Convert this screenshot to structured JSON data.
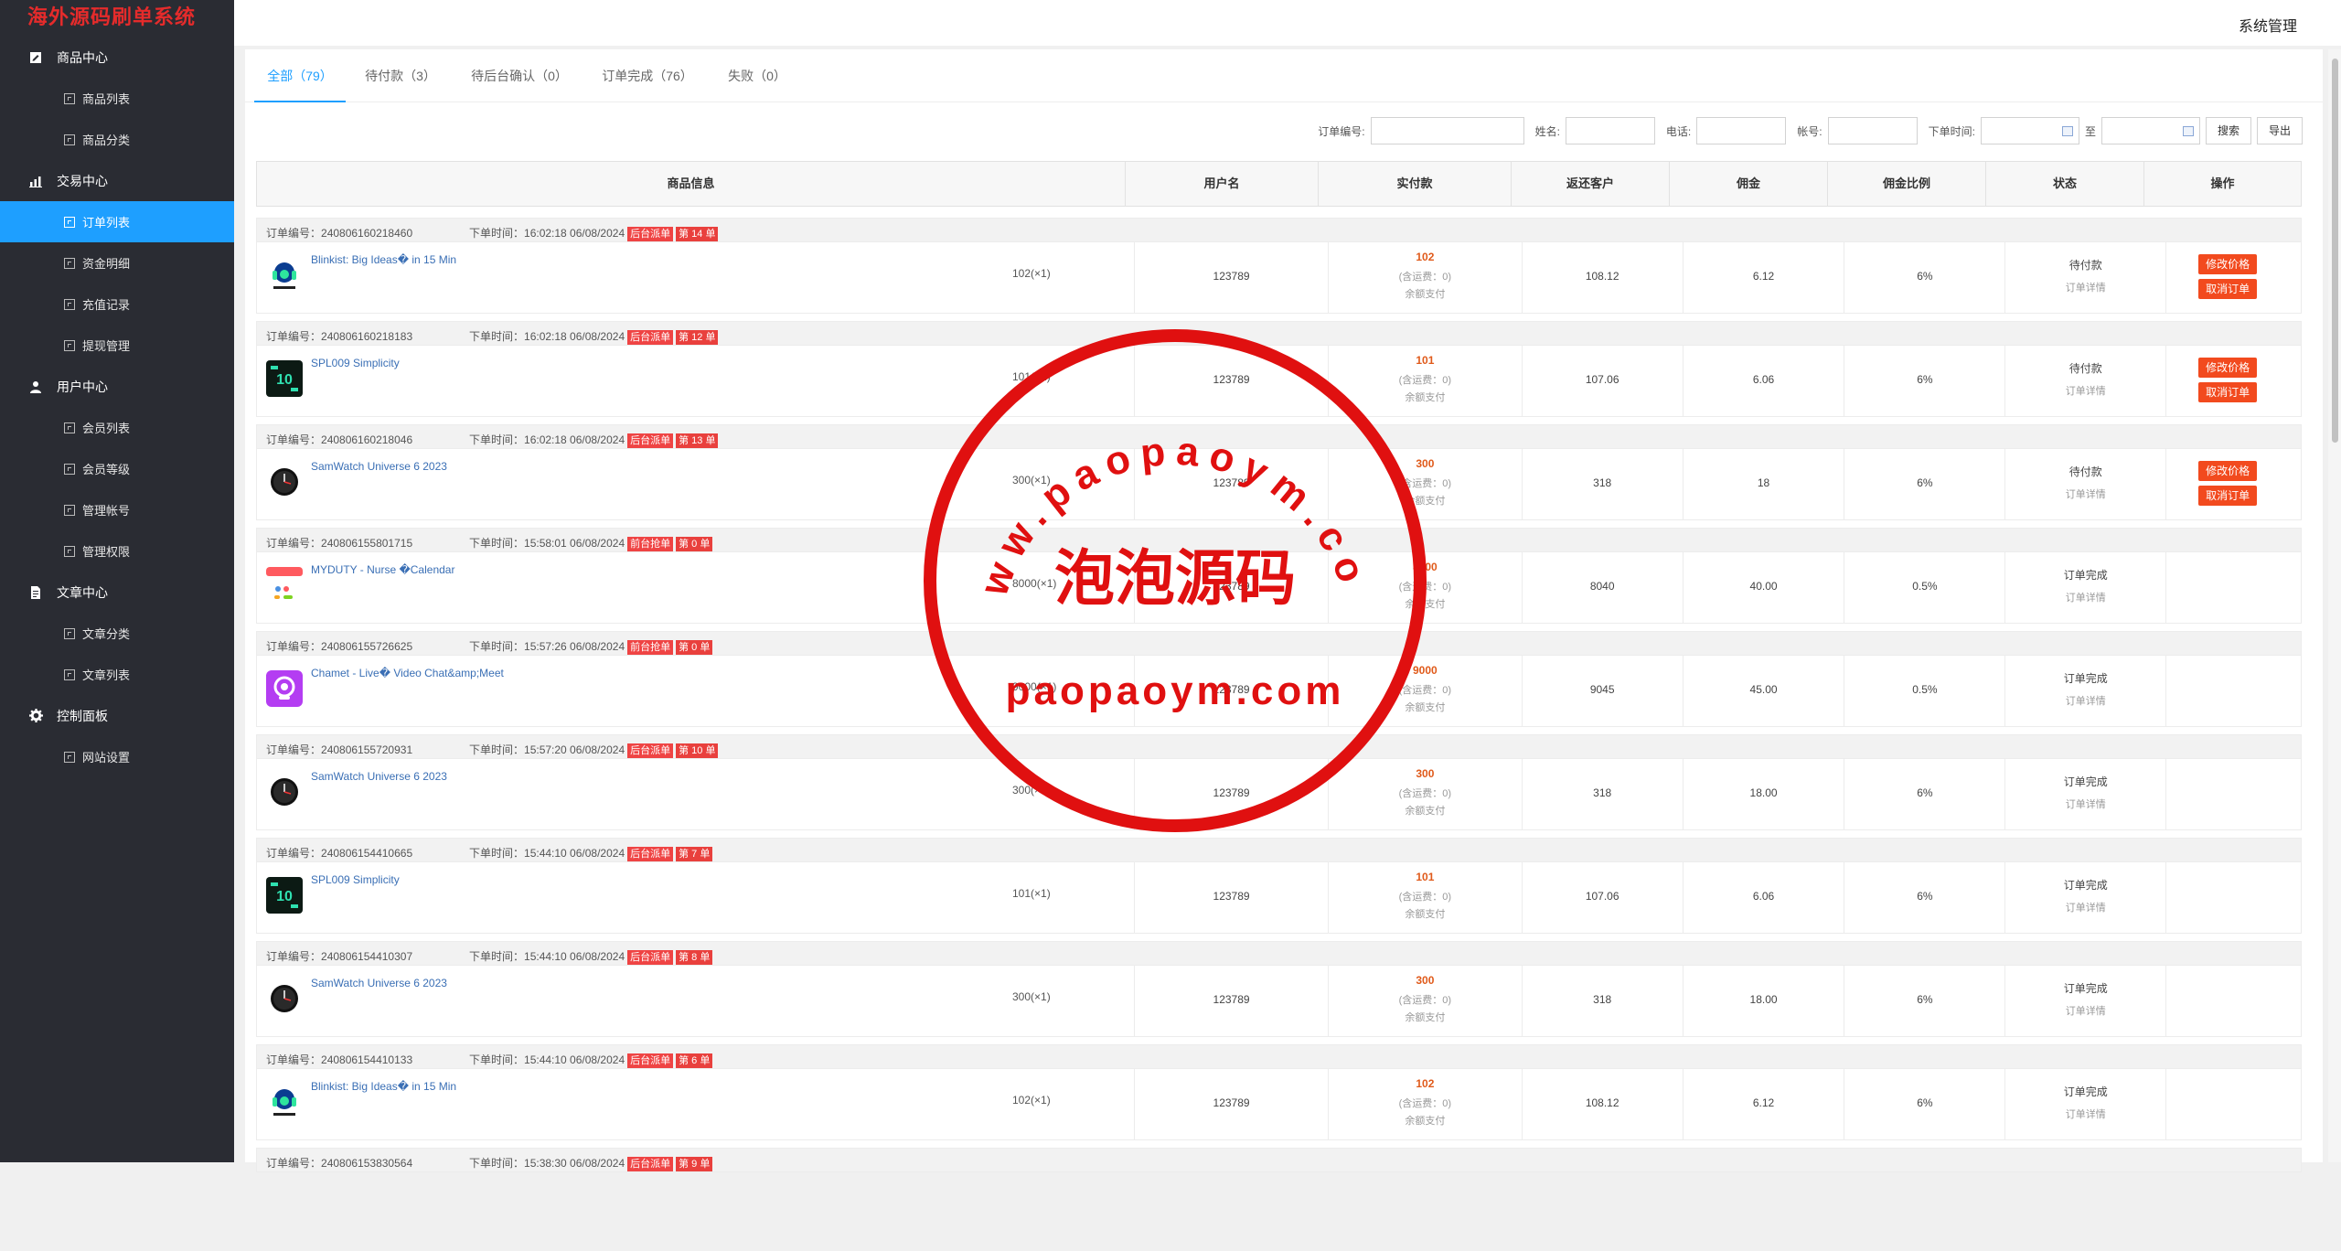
{
  "brand": "海外源码刷单系统",
  "header": {
    "title": "系统管理"
  },
  "sidebar": {
    "groups": [
      {
        "label": "商品中心",
        "icon": "edit-icon",
        "items": [
          "商品列表",
          "商品分类"
        ]
      },
      {
        "label": "交易中心",
        "icon": "bar-chart-icon",
        "items": [
          "订单列表",
          "资金明细",
          "充值记录",
          "提现管理"
        ]
      },
      {
        "label": "用户中心",
        "icon": "user-icon",
        "items": [
          "会员列表",
          "会员等级",
          "管理帐号",
          "管理权限"
        ]
      },
      {
        "label": "文章中心",
        "icon": "document-icon",
        "items": [
          "文章分类",
          "文章列表"
        ]
      },
      {
        "label": "控制面板",
        "icon": "gear-icon",
        "items": [
          "网站设置"
        ]
      }
    ],
    "active_item": "订单列表"
  },
  "tabs": [
    {
      "label": "全部（79）",
      "active": true
    },
    {
      "label": "待付款（3）",
      "active": false
    },
    {
      "label": "待后台确认（0）",
      "active": false
    },
    {
      "label": "订单完成（76）",
      "active": false
    },
    {
      "label": "失败（0）",
      "active": false
    }
  ],
  "filters": {
    "order_no_label": "订单编号:",
    "name_label": "姓名:",
    "phone_label": "电话:",
    "account_label": "帐号:",
    "time_label": "下单时间:",
    "to_label": "至",
    "search_btn": "搜索",
    "export_btn": "导出"
  },
  "columns": [
    "商品信息",
    "用户名",
    "实付款",
    "返还客户",
    "佣金",
    "佣金比例",
    "状态",
    "操作"
  ],
  "labels": {
    "order_no_prefix": "订单编号：",
    "order_time_prefix": "下单时间：",
    "ship_fee": "(含运费：0)",
    "pay_mode": "余额支付",
    "detail": "订单详情",
    "edit_price": "修改价格",
    "cancel_order": "取消订单"
  },
  "orders": [
    {
      "no": "240806160218460",
      "time": "16:02:18 06/08/2024",
      "badge": "后台派单",
      "count": "第 14 单",
      "product": "Blinkist: Big Ideas� in 15 Min",
      "thumb": "blinkist",
      "qty": "102(×1)",
      "user": "123789",
      "paid": "102",
      "refund": "108.12",
      "commission": "6.12",
      "rate": "6%",
      "status": "待付款",
      "actions": true
    },
    {
      "no": "240806160218183",
      "time": "16:02:18 06/08/2024",
      "badge": "后台派单",
      "count": "第 12 单",
      "product": "SPL009 Simplicity",
      "thumb": "watch10",
      "qty": "101(×1)",
      "user": "123789",
      "paid": "101",
      "refund": "107.06",
      "commission": "6.06",
      "rate": "6%",
      "status": "待付款",
      "actions": true
    },
    {
      "no": "240806160218046",
      "time": "16:02:18 06/08/2024",
      "badge": "后台派单",
      "count": "第 13 单",
      "product": "SamWatch Universe 6 2023",
      "thumb": "samwatch",
      "qty": "300(×1)",
      "user": "123789",
      "paid": "300",
      "refund": "318",
      "commission": "18",
      "rate": "6%",
      "status": "待付款",
      "actions": true
    },
    {
      "no": "240806155801715",
      "time": "15:58:01 06/08/2024",
      "badge": "前台抢单",
      "count": "第 0 单",
      "product": "MYDUTY - Nurse �Calendar",
      "thumb": "myduty",
      "qty": "8000(×1)",
      "user": "123789",
      "paid": "8000",
      "refund": "8040",
      "commission": "40.00",
      "rate": "0.5%",
      "status": "订单完成",
      "actions": false
    },
    {
      "no": "240806155726625",
      "time": "15:57:26 06/08/2024",
      "badge": "前台抢单",
      "count": "第 0 单",
      "product": "Chamet - Live� Video Chat&amp;Meet",
      "thumb": "chamet",
      "qty": "9000(×1)",
      "user": "123789",
      "paid": "9000",
      "refund": "9045",
      "commission": "45.00",
      "rate": "0.5%",
      "status": "订单完成",
      "actions": false
    },
    {
      "no": "240806155720931",
      "time": "15:57:20 06/08/2024",
      "badge": "后台派单",
      "count": "第 10 单",
      "product": "SamWatch Universe 6 2023",
      "thumb": "samwatch",
      "qty": "300(×1)",
      "user": "123789",
      "paid": "300",
      "refund": "318",
      "commission": "18.00",
      "rate": "6%",
      "status": "订单完成",
      "actions": false
    },
    {
      "no": "240806154410665",
      "time": "15:44:10 06/08/2024",
      "badge": "后台派单",
      "count": "第 7 单",
      "product": "SPL009 Simplicity",
      "thumb": "watch10",
      "qty": "101(×1)",
      "user": "123789",
      "paid": "101",
      "refund": "107.06",
      "commission": "6.06",
      "rate": "6%",
      "status": "订单完成",
      "actions": false
    },
    {
      "no": "240806154410307",
      "time": "15:44:10 06/08/2024",
      "badge": "后台派单",
      "count": "第 8 单",
      "product": "SamWatch Universe 6 2023",
      "thumb": "samwatch",
      "qty": "300(×1)",
      "user": "123789",
      "paid": "300",
      "refund": "318",
      "commission": "18.00",
      "rate": "6%",
      "status": "订单完成",
      "actions": false
    },
    {
      "no": "240806154410133",
      "time": "15:44:10 06/08/2024",
      "badge": "后台派单",
      "count": "第 6 单",
      "product": "Blinkist: Big Ideas� in 15 Min",
      "thumb": "blinkist",
      "qty": "102(×1)",
      "user": "123789",
      "paid": "102",
      "refund": "108.12",
      "commission": "6.12",
      "rate": "6%",
      "status": "订单完成",
      "actions": false
    },
    {
      "no": "240806153830564",
      "time": "15:38:30 06/08/2024",
      "badge": "后台派单",
      "count": "第 9 单",
      "product": "",
      "thumb": "",
      "qty": "",
      "user": "",
      "paid": "",
      "refund": "",
      "commission": "",
      "rate": "",
      "status": "",
      "actions": false
    }
  ],
  "watermark": {
    "arc_text": "www.paopaoym.com",
    "center_text": "泡泡源码",
    "bottom_text": "paopaoym.com",
    "color": "#e01010"
  },
  "colors": {
    "sidebar_bg": "#2a2c33",
    "accent": "#1e9fff",
    "brand": "#e52b2b",
    "badge": "#ef4444",
    "action_btn": "#f24a1e",
    "price": "#e05a1a"
  }
}
